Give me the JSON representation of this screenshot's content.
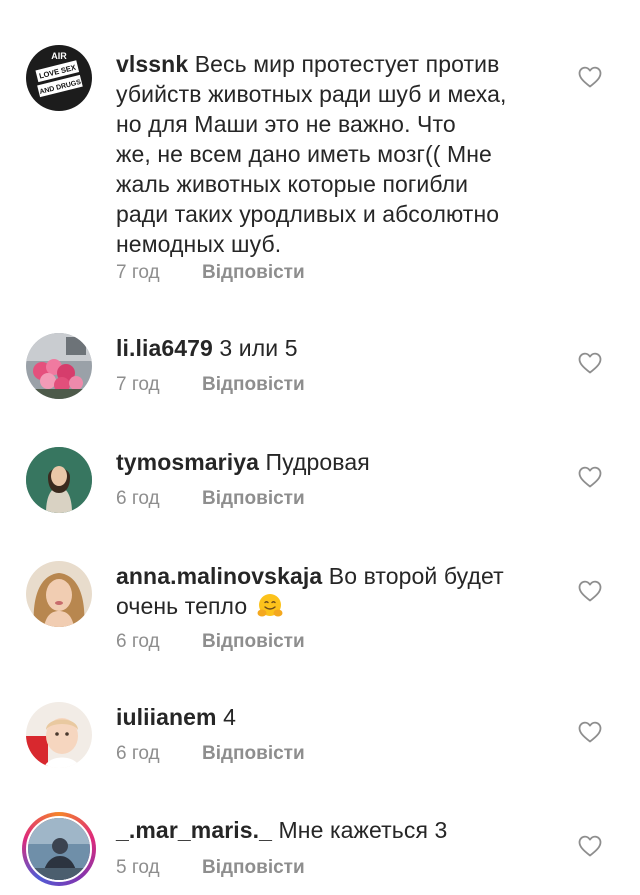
{
  "comments": [
    {
      "username": "vlssnk",
      "lines": [
        "Весь мир протестует против",
        "убийств животных ради шуб и меха,",
        "но для Маши это не важно.  Что",
        "же, не всем дано иметь мозг(( Мне",
        "жаль животных которые погибли",
        "ради таких уродливых и абсолютно",
        "немодных шуб."
      ],
      "time": "7 год",
      "reply": "Відповісти",
      "avatar_icon": "avatar-graphic-icon",
      "avatar_caption_1": "LOVE SEX",
      "avatar_caption_2": "AND DRUGS",
      "avatar_caption_top": "AIR"
    },
    {
      "username": "li.lia6479",
      "text": "3 или 5",
      "time": "7 год",
      "reply": "Відповісти",
      "avatar_icon": "flowers-photo-icon"
    },
    {
      "username": "tymosmariya",
      "text": "Пудровая",
      "time": "6 год",
      "reply": "Відповісти",
      "avatar_icon": "woman-portrait-icon"
    },
    {
      "username": "anna.malinovskaja",
      "text": "Во второй будет",
      "text_line2": "очень тепло",
      "emoji": "hugging-face-emoji",
      "time": "6 год",
      "reply": "Відповісти",
      "avatar_icon": "woman-portrait-icon"
    },
    {
      "username": "iuliianem",
      "text": "4",
      "time": "6 год",
      "reply": "Відповісти",
      "avatar_icon": "baby-photo-icon"
    },
    {
      "username": "_.mar_maris._",
      "text": "Мне кажеться 3",
      "time": "5 год",
      "reply": "Відповісти",
      "avatar_icon": "person-photo-icon",
      "story_ring": true
    }
  ],
  "colors": {
    "text": "#262626",
    "secondary": "#8e8e8e",
    "background": "#ffffff"
  }
}
